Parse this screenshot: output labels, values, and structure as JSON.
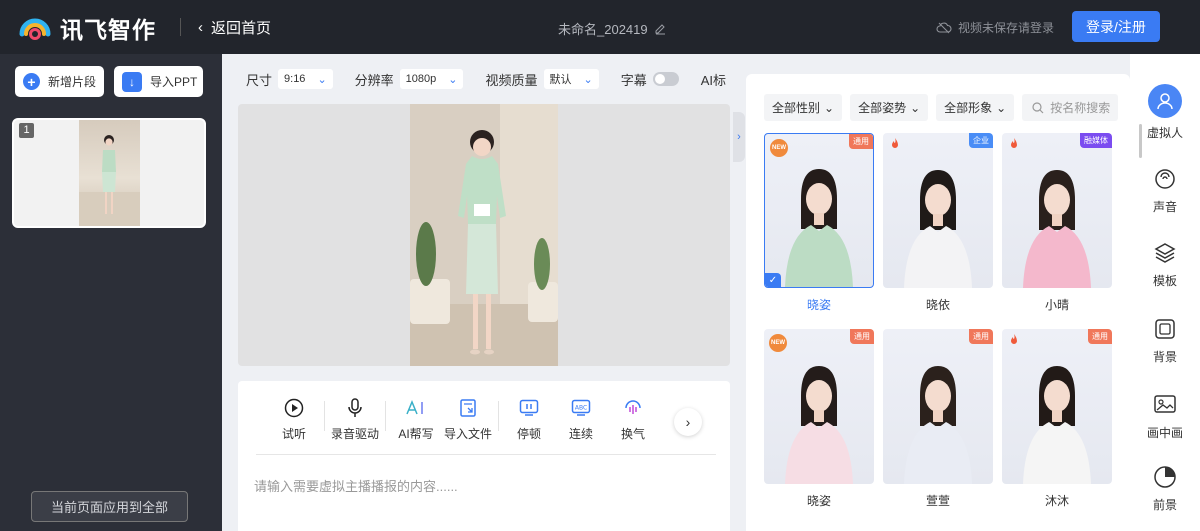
{
  "header": {
    "logo_text": "讯飞智作",
    "back_label": "返回首页",
    "doc_title": "未命名_202419",
    "save_hint": "视频未保存请登录",
    "login_label": "登录/注册"
  },
  "left_panel": {
    "add_segment_label": "新增片段",
    "import_ppt_label": "导入PPT",
    "slides": [
      {
        "number": "1"
      }
    ],
    "apply_all_label": "当前页面应用到全部"
  },
  "settings": {
    "size_label": "尺寸",
    "size_value": "9:16",
    "resolution_label": "分辨率",
    "resolution_value": "1080p",
    "quality_label": "视频质量",
    "quality_value": "默认",
    "subtitle_label": "字幕",
    "ai_label": "AI标"
  },
  "toolbar": {
    "tools": [
      {
        "label": "试听",
        "icon": "play-circle-icon"
      },
      {
        "label": "录音驱动",
        "icon": "microphone-icon"
      },
      {
        "label": "AI帮写",
        "icon": "ai-write-icon"
      },
      {
        "label": "导入文件",
        "icon": "import-file-icon"
      },
      {
        "label": "停顿",
        "icon": "pause-icon"
      },
      {
        "label": "连续",
        "icon": "continuous-icon"
      },
      {
        "label": "换气",
        "icon": "breath-icon"
      }
    ],
    "script_placeholder": "请输入需要虚拟主播播报的内容......"
  },
  "avatar_panel": {
    "filters": {
      "gender": "全部性别",
      "pose": "全部姿势",
      "image": "全部形象"
    },
    "search_placeholder": "按名称搜索",
    "avatars": [
      {
        "name": "晓姿",
        "tag": "通用",
        "badge": "NEW",
        "selected": true,
        "outfit": "#bcdcc4"
      },
      {
        "name": "晓依",
        "tag": "企业",
        "badge": "hot",
        "selected": false,
        "outfit": "#f3f3f5"
      },
      {
        "name": "小晴",
        "tag": "融媒体",
        "badge": "hot",
        "selected": false,
        "outfit": "#f4b8cc"
      },
      {
        "name": "晓姿",
        "tag": "通用",
        "badge": "NEW",
        "selected": false,
        "outfit": "#f6dde4"
      },
      {
        "name": "萱萱",
        "tag": "通用",
        "badge": "",
        "selected": false,
        "outfit": "#e9ecf4"
      },
      {
        "name": "沐沐",
        "tag": "通用",
        "badge": "hot",
        "selected": false,
        "outfit": "#f5f5f5"
      }
    ]
  },
  "side_nav": [
    {
      "label": "虚拟人",
      "icon": "avatar-icon"
    },
    {
      "label": "声音",
      "icon": "voice-icon"
    },
    {
      "label": "模板",
      "icon": "template-icon"
    },
    {
      "label": "背景",
      "icon": "background-icon"
    },
    {
      "label": "画中画",
      "icon": "picture-in-picture-icon"
    },
    {
      "label": "前景",
      "icon": "foreground-icon"
    }
  ],
  "colors": {
    "accent": "#3a7bf3",
    "header_bg": "#22252c",
    "left_bg": "#2c2f38"
  }
}
